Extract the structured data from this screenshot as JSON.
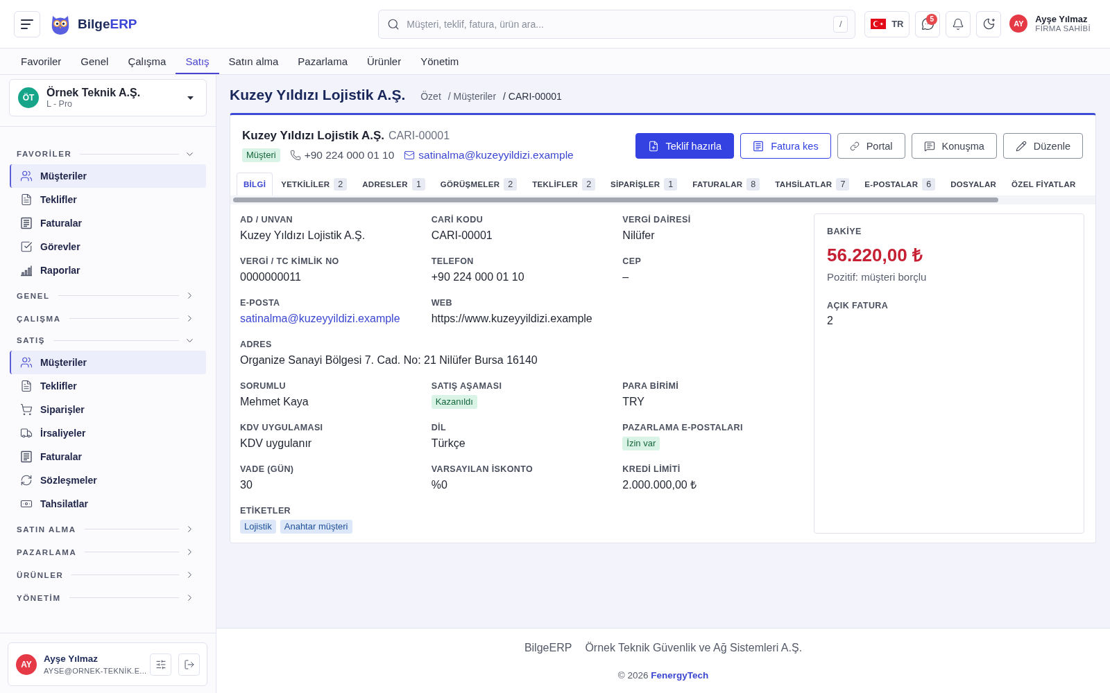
{
  "header": {
    "brand": {
      "prefix": "Bilge",
      "suffix": "ERP"
    },
    "search": {
      "placeholder": "Müşteri, teklif, fatura, ürün ara...",
      "shortcut": "/"
    },
    "language": {
      "code": "TR"
    },
    "messages": {
      "unread": "5"
    },
    "user": {
      "initials": "AY",
      "name": "Ayşe Yılmaz",
      "role": "FİRMA SAHİBİ"
    }
  },
  "nav_tabs": [
    {
      "label": "Favoriler",
      "selected": false
    },
    {
      "label": "Genel",
      "selected": false
    },
    {
      "label": "Çalışma",
      "selected": false
    },
    {
      "label": "Satış",
      "selected": true
    },
    {
      "label": "Satın alma",
      "selected": false
    },
    {
      "label": "Pazarlama",
      "selected": false
    },
    {
      "label": "Ürünler",
      "selected": false
    },
    {
      "label": "Yönetim",
      "selected": false
    }
  ],
  "sidebar": {
    "company": {
      "initials": "ÖT",
      "name": "Örnek Teknik A.Ş.",
      "plan": "L - Pro"
    },
    "sections": [
      {
        "title": "FAVORİLER",
        "expanded": true,
        "items": [
          {
            "label": "Müşteriler",
            "kind": "customers",
            "selected": true
          },
          {
            "label": "Teklifler",
            "kind": "quotes",
            "selected": false
          },
          {
            "label": "Faturalar",
            "kind": "invoices",
            "selected": false
          },
          {
            "label": "Görevler",
            "kind": "tasks",
            "selected": false
          },
          {
            "label": "Raporlar",
            "kind": "reports",
            "selected": false
          }
        ]
      },
      {
        "title": "GENEL",
        "expanded": false
      },
      {
        "title": "ÇALIŞMA",
        "expanded": false
      },
      {
        "title": "SATIŞ",
        "expanded": true,
        "items": [
          {
            "label": "Müşteriler",
            "kind": "customers",
            "selected": true
          },
          {
            "label": "Teklifler",
            "kind": "quotes",
            "selected": false
          },
          {
            "label": "Siparişler",
            "kind": "orders",
            "selected": false
          },
          {
            "label": "İrsaliyeler",
            "kind": "deliveries",
            "selected": false
          },
          {
            "label": "Faturalar",
            "kind": "invoices",
            "selected": false
          },
          {
            "label": "Sözleşmeler",
            "kind": "contracts",
            "selected": false
          },
          {
            "label": "Tahsilatlar",
            "kind": "payments",
            "selected": false
          }
        ]
      },
      {
        "title": "SATIN ALMA",
        "expanded": false
      },
      {
        "title": "PAZARLAMA",
        "expanded": false
      },
      {
        "title": "ÜRÜNLER",
        "expanded": false
      },
      {
        "title": "YÖNETİM",
        "expanded": false
      }
    ],
    "user": {
      "initials": "AY",
      "name": "Ayşe Yılmaz",
      "email": "AYSE@ORNEK-TEKNİK.E..."
    }
  },
  "page": {
    "title": "Kuzey Yıldızı Lojistik A.Ş.",
    "breadcrumb": [
      "Özet",
      "/ Müşteriler",
      "/ CARI-00001"
    ]
  },
  "customer": {
    "name": "Kuzey Yıldızı Lojistik A.Ş.",
    "code": "CARI-00001",
    "status": "Müşteri",
    "phone": "+90 224 000 01 10",
    "email": "satinalma@kuzeyyildizi.example",
    "actions": [
      {
        "label": "Teklif hazırla",
        "kind": "quote"
      },
      {
        "label": "Fatura kes",
        "kind": "invoice"
      },
      {
        "label": "Portal",
        "kind": "portal"
      },
      {
        "label": "Konuşma",
        "kind": "chat"
      },
      {
        "label": "Düzenle",
        "kind": "edit"
      }
    ],
    "tabs": [
      {
        "label": "BİLGİ",
        "selected": true
      },
      {
        "label": "YETKİLİLER",
        "count": "2",
        "selected": false
      },
      {
        "label": "ADRESLER",
        "count": "1",
        "selected": false
      },
      {
        "label": "GÖRÜŞMELER",
        "count": "2",
        "selected": false
      },
      {
        "label": "TEKLİFLER",
        "count": "2",
        "selected": false
      },
      {
        "label": "SİPARİŞLER",
        "count": "1",
        "selected": false
      },
      {
        "label": "FATURALAR",
        "count": "8",
        "selected": false
      },
      {
        "label": "TAHSİLATLAR",
        "count": "7",
        "selected": false
      },
      {
        "label": "E-POSTALAR",
        "count": "6",
        "selected": false
      },
      {
        "label": "DOSYALAR",
        "selected": false
      },
      {
        "label": "ÖZEL FİYATLAR",
        "selected": false
      }
    ],
    "detail_rows": [
      {
        "fields": [
          {
            "label": "AD / UNVAN",
            "kind": "text",
            "value": "Kuzey Yıldızı Lojistik A.Ş."
          },
          {
            "label": "CARİ KODU",
            "kind": "text",
            "value": "CARI-00001"
          },
          {
            "label": "VERGİ DAİRESİ",
            "kind": "text",
            "value": "Nilüfer"
          }
        ]
      },
      {
        "fields": [
          {
            "label": "VERGİ / TC KİMLİK NO",
            "kind": "text",
            "value": "0000000011"
          },
          {
            "label": "TELEFON",
            "kind": "text",
            "value": "+90 224 000 01 10"
          },
          {
            "label": "CEP",
            "kind": "text",
            "value": "–"
          }
        ]
      },
      {
        "fields": [
          {
            "label": "E-POSTA",
            "kind": "link",
            "value": "satinalma@kuzeyyildizi.example"
          },
          {
            "label": "WEB",
            "kind": "text",
            "value": "https://www.kuzeyyildizi.example"
          }
        ]
      },
      {
        "fields": [
          {
            "label": "ADRES",
            "kind": "text",
            "value": "Organize Sanayi Bölgesi 7. Cad. No: 21 Nilüfer Bursa 16140"
          }
        ]
      },
      {
        "fields": [
          {
            "label": "SORUMLU",
            "kind": "text",
            "value": "Mehmet Kaya"
          },
          {
            "label": "SATIŞ AŞAMASI",
            "kind": "badge",
            "value": "Kazanıldı"
          },
          {
            "label": "PARA BİRİMİ",
            "kind": "text",
            "value": "TRY"
          }
        ]
      },
      {
        "fields": [
          {
            "label": "KDV UYGULAMASI",
            "kind": "text",
            "value": "KDV uygulanır"
          },
          {
            "label": "DİL",
            "kind": "text",
            "value": "Türkçe"
          },
          {
            "label": "PAZARLAMA E-POSTALARI",
            "kind": "badge",
            "value": "İzin var"
          }
        ]
      },
      {
        "fields": [
          {
            "label": "VADE (GÜN)",
            "kind": "text",
            "value": "30"
          },
          {
            "label": "VARSAYILAN İSKONTO",
            "kind": "text",
            "value": "%0"
          },
          {
            "label": "KREDİ LİMİTİ",
            "kind": "text",
            "value": "2.000.000,00 ₺"
          }
        ]
      },
      {
        "fields": [
          {
            "label": "ETİKETLER",
            "kind": "tags",
            "tags": [
              "Lojistik",
              "Anahtar müşteri"
            ]
          }
        ]
      }
    ],
    "summary": {
      "balance_label": "BAKİYE",
      "balance": "56.220,00 ₺",
      "balance_note": "Pozitif: müşteri borçlu",
      "open_invoices_label": "AÇIK FATURA",
      "open_invoices": "2"
    }
  },
  "footer": {
    "brand": "BilgeERP",
    "company": "Örnek Teknik Güvenlik ve Ağ Sistemleri A.Ş.",
    "copyright": "© 2026",
    "link": "FenergyTech"
  }
}
